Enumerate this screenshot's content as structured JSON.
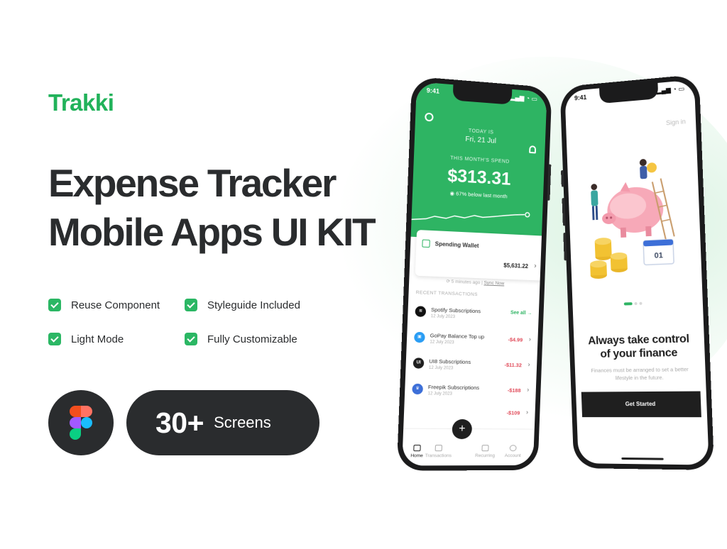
{
  "brand": "Trakki",
  "headline": {
    "line1": "Expense Tracker",
    "line2": "Mobile Apps UI KIT"
  },
  "features": [
    "Reuse Component",
    "Styleguide Included",
    "Light Mode",
    "Fully Customizable"
  ],
  "screens": {
    "count": "30+",
    "label": "Screens"
  },
  "colors": {
    "accent": "#2eb463",
    "dark": "#2a2c2e",
    "negative": "#e14b5a"
  },
  "phone_home": {
    "time": "9:41",
    "today_label": "TODAY IS",
    "date": "Fri, 21 Jul",
    "spend_label": "THIS MONTH'S SPEND",
    "spend_amount": "$313.31",
    "spend_note": "67% below last month",
    "wallet": {
      "title": "Spending Wallet",
      "amount": "$5,631.22"
    },
    "sync_text": "5 minutes ago",
    "sync_link": "Sync Now",
    "recent_label": "RECENT TRANSACTIONS",
    "see_all": "See all",
    "transactions": [
      {
        "name": "Spotify Subscriptions",
        "date": "12 July 2023",
        "amount": "",
        "icon": "spotify-icon",
        "color": "#111111"
      },
      {
        "name": "GoPay Balance Top up",
        "date": "12 July 2023",
        "amount": "-$4.99",
        "icon": "gopay-icon",
        "color": "#2a9df4"
      },
      {
        "name": "UI8 Subscriptions",
        "date": "12 July 2023",
        "amount": "-$11.32",
        "icon": "ui8-icon",
        "color": "#1f1f1f"
      },
      {
        "name": "Freepik Subscriptions",
        "date": "12 July 2023",
        "amount": "-$188",
        "icon": "freepik-icon",
        "color": "#3d6fd8"
      },
      {
        "name": "",
        "date": "",
        "amount": "-$109",
        "icon": "",
        "color": "#cccccc"
      }
    ],
    "tabs": [
      "Home",
      "Transactions",
      "Recurring",
      "Account"
    ],
    "fab": "+"
  },
  "phone_onboard": {
    "time": "9:41",
    "signin": "Sign in",
    "calendar_day": "01",
    "title_line1": "Always take control",
    "title_line2": "of your finance",
    "subtitle_line1": "Finances must be arranged to set a better",
    "subtitle_line2": "lifestyle in the future.",
    "button": "Get Started"
  }
}
